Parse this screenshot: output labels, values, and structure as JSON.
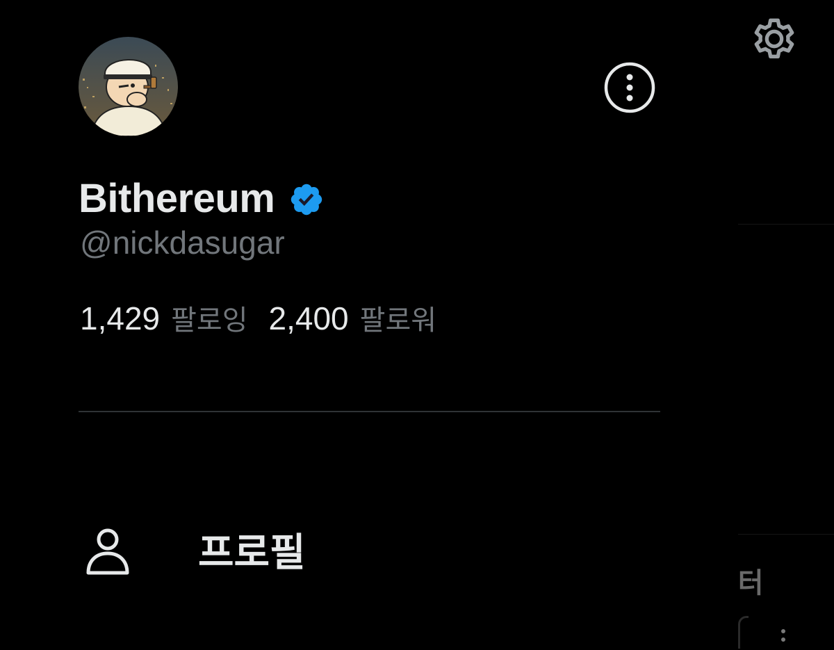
{
  "profile": {
    "display_name": "Bithereum",
    "handle": "@nickdasugar",
    "verified": true,
    "following_count": "1,429",
    "following_label": "팔로잉",
    "followers_count": "2,400",
    "followers_label": "팔로워"
  },
  "menu": {
    "items": [
      {
        "label": "프로필",
        "icon": "person-icon"
      }
    ]
  },
  "background_page": {
    "partial_text": "l터"
  },
  "icons": {
    "settings": "gear-icon",
    "more": "more-vertical-circle-icon",
    "verified": "verified-badge-icon"
  },
  "colors": {
    "background": "#000000",
    "primary_text": "#e7e9ea",
    "secondary_text": "#71767b",
    "divider": "#2f3336",
    "verified_blue": "#1d9bf0"
  }
}
